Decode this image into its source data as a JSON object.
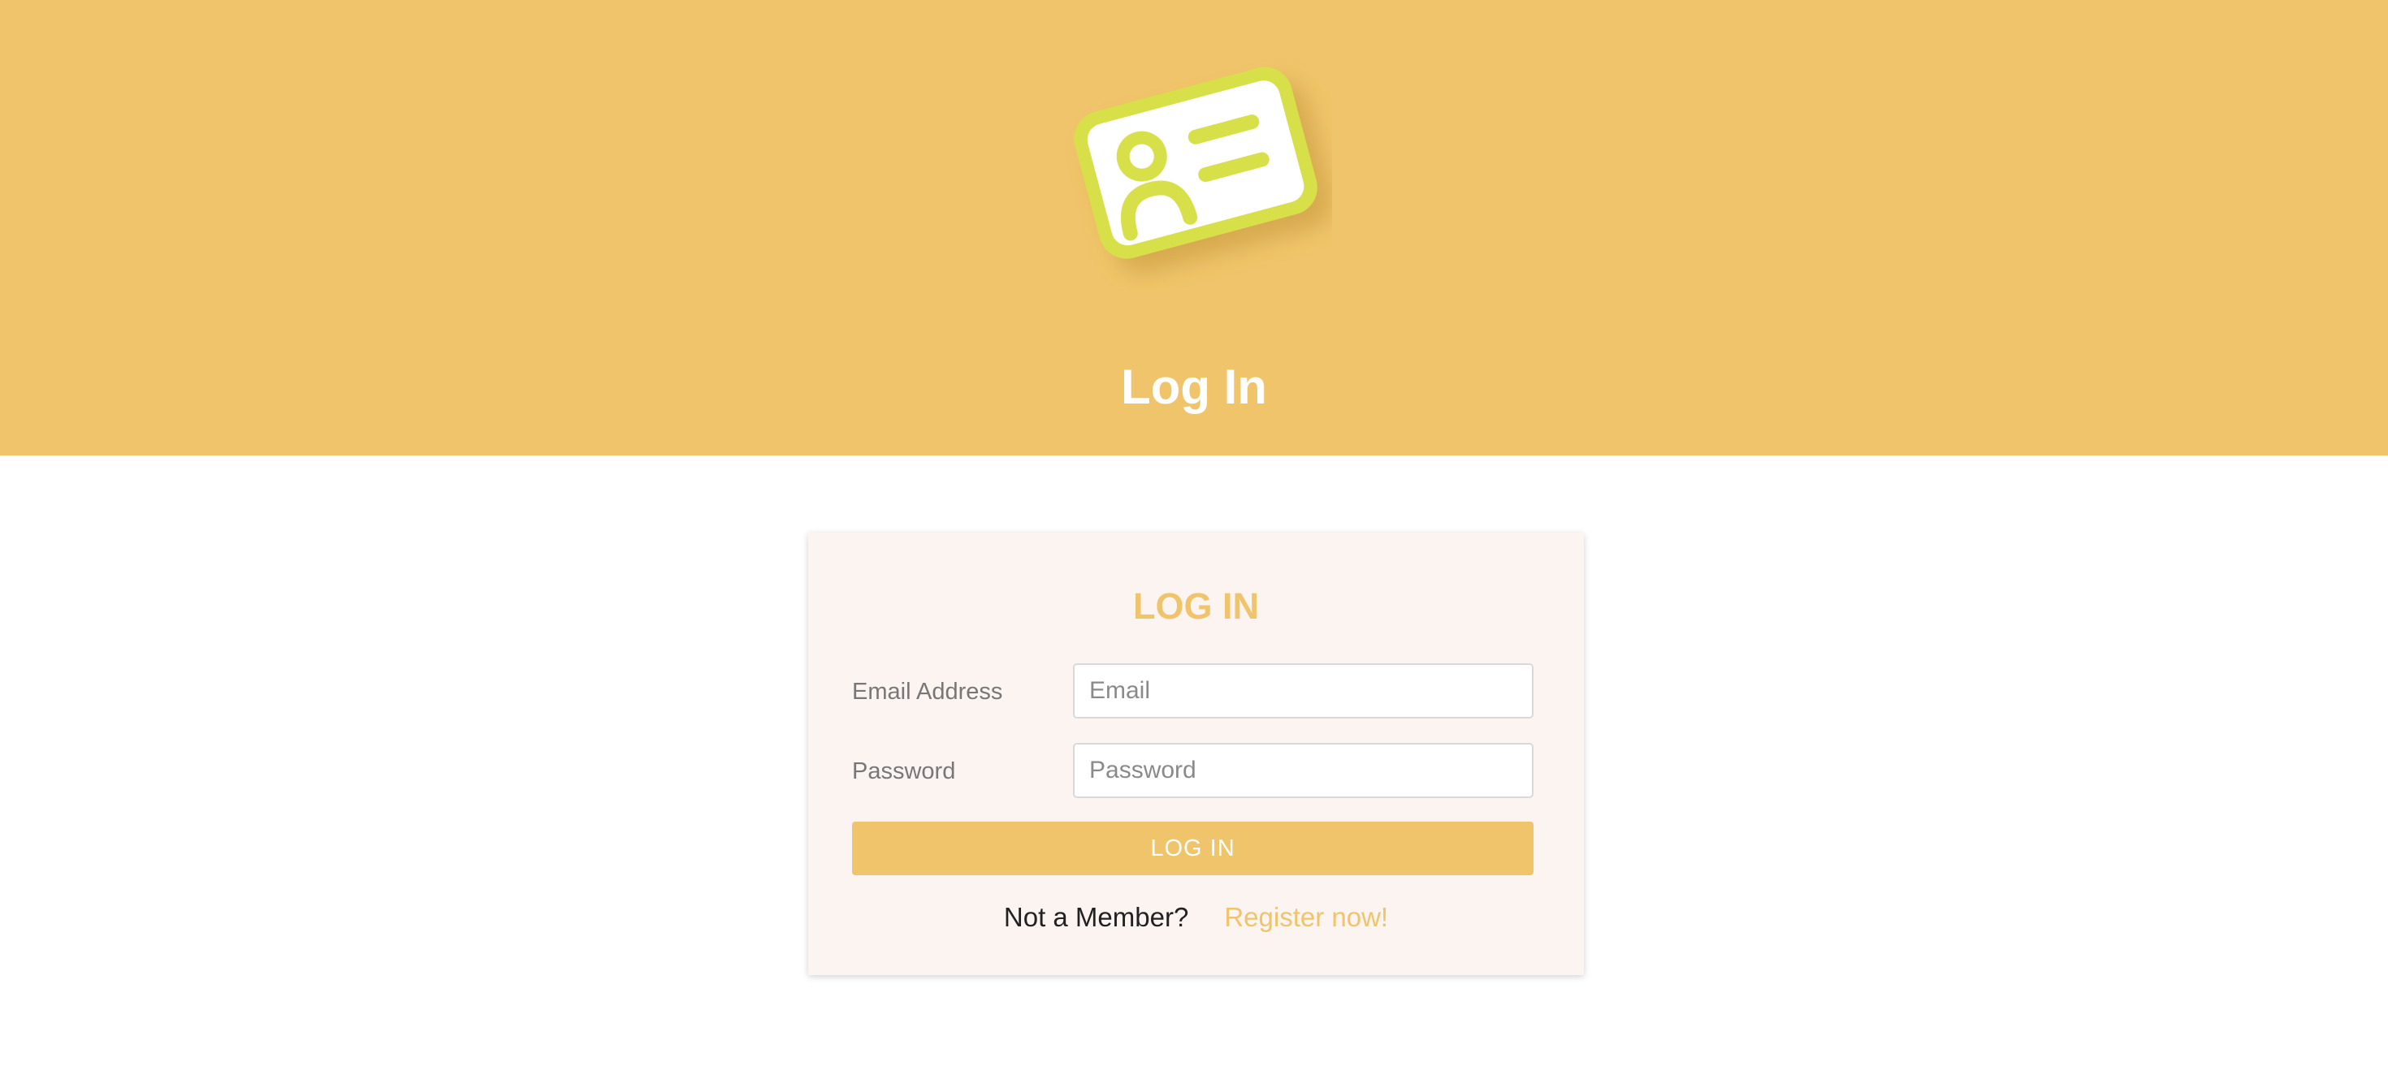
{
  "hero": {
    "title": "Log In",
    "icon": "id-card-icon"
  },
  "login_card": {
    "title": "LOG IN",
    "email": {
      "label": "Email Address",
      "placeholder": "Email",
      "value": ""
    },
    "password": {
      "label": "Password",
      "placeholder": "Password",
      "value": ""
    },
    "submit_label": "LOG IN",
    "register_prompt": "Not a Member?",
    "register_link": "Register now!"
  },
  "colors": {
    "accent": "#f0c46a",
    "icon_frame": "#d8e04a",
    "card_background": "#fcf4f1"
  }
}
